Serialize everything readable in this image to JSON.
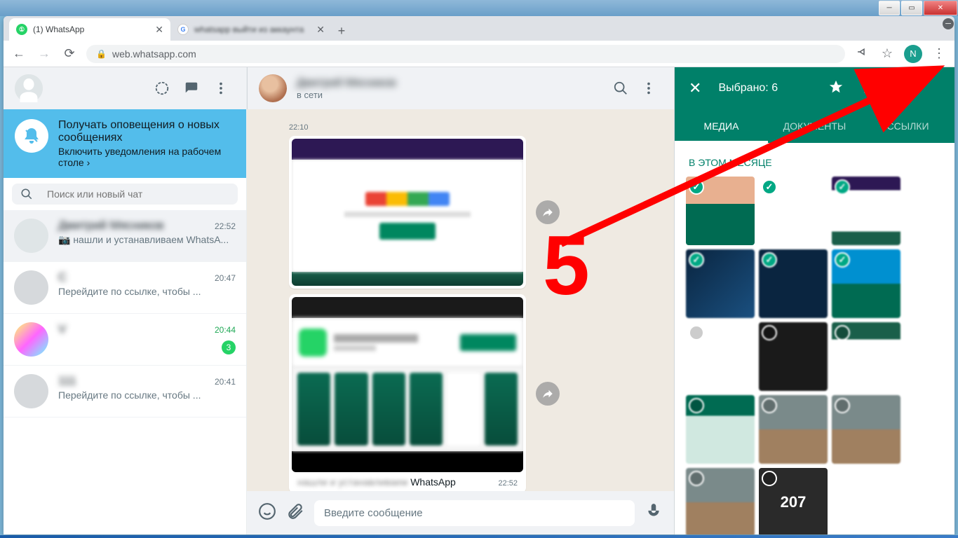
{
  "browser": {
    "tabs": [
      {
        "title": "(1) WhatsApp",
        "favicon": "wa"
      },
      {
        "title": "whatsapp выйти из аккаунта",
        "favicon": "gg"
      }
    ],
    "url": "web.whatsapp.com",
    "profile_letter": "N"
  },
  "sidebar": {
    "notification": {
      "title": "Получать оповещения о новых сообщениях",
      "subtitle": "Включить уведомления на рабочем столе ›"
    },
    "search_placeholder": "Поиск или новый чат",
    "chats": [
      {
        "name": "Дмитрий Мясников",
        "time": "22:52",
        "msg": "📷 нашли и устанавливаем WhatsA...",
        "active": true
      },
      {
        "name": "C",
        "time": "20:47",
        "msg": "Перейдите по ссылке, чтобы ..."
      },
      {
        "name": "V",
        "time": "20:44",
        "msg": "",
        "unread": "3"
      },
      {
        "name": "111",
        "time": "20:41",
        "msg": "Перейдите по ссылке, чтобы ..."
      }
    ]
  },
  "chat": {
    "contact_name": "Дмитрий Мясников",
    "status": "в сети",
    "messages": [
      {
        "time": "22:10"
      },
      {
        "caption_blur": "нашли и устанавливаем",
        "caption": "WhatsApp",
        "time": "22:52"
      }
    ],
    "composer_placeholder": "Введите сообщение"
  },
  "media_panel": {
    "selected_label": "Выбрано: 6",
    "tabs": [
      "МЕДИА",
      "ДОКУМЕНТЫ",
      "ССЫЛКИ"
    ],
    "section": "В ЭТОМ МЕСЯЦЕ",
    "thumbs": [
      {
        "sel": true
      },
      {
        "sel": true
      },
      {
        "sel": true
      },
      {
        "sel": true
      },
      {
        "sel": true
      },
      {
        "sel": true
      },
      {
        "sel": false
      },
      {
        "sel": false
      },
      {
        "sel": false
      },
      {
        "sel": false
      },
      {
        "sel": false
      },
      {
        "sel": false
      },
      {
        "sel": false
      },
      {
        "label": "207"
      }
    ]
  },
  "annotation": {
    "number": "5"
  }
}
